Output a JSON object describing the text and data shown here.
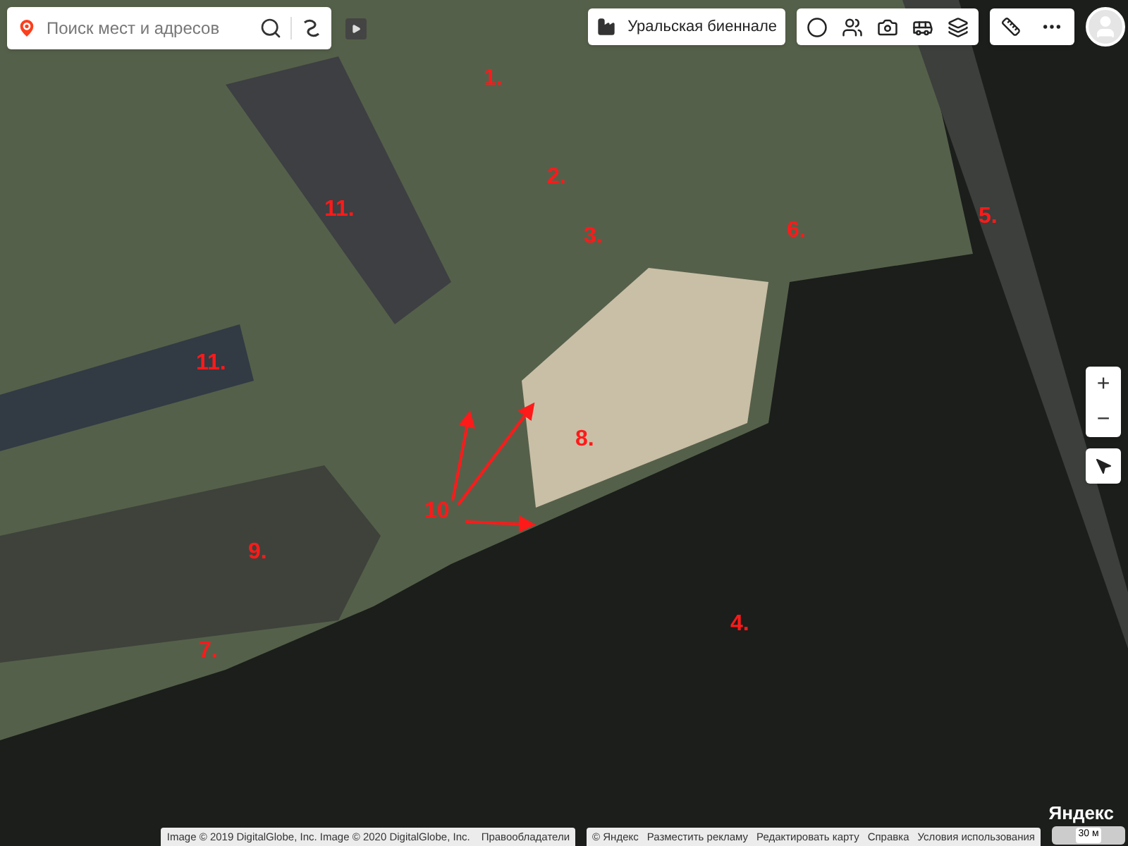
{
  "search": {
    "placeholder": "Поиск мест и адресов"
  },
  "layer_chip": {
    "label": "Уральская биеннале"
  },
  "annotations": [
    {
      "label": "1."
    },
    {
      "label": "2."
    },
    {
      "label": "3."
    },
    {
      "label": "4."
    },
    {
      "label": "5."
    },
    {
      "label": "6."
    },
    {
      "label": "7."
    },
    {
      "label": "8."
    },
    {
      "label": "9."
    },
    {
      "label": "10"
    },
    {
      "label": "11."
    },
    {
      "label": "11."
    }
  ],
  "zoom": {
    "plus": "+",
    "minus": "−"
  },
  "footer": {
    "imagery": "Image © 2019 DigitalGlobe, Inc. Image © 2020 DigitalGlobe, Inc.",
    "rights": "Правообладатели",
    "links": [
      "© Яндекс",
      "Разместить рекламу",
      "Редактировать карту",
      "Справка",
      "Условия использования"
    ]
  },
  "logo": "Яндекс",
  "scale": "30 м"
}
